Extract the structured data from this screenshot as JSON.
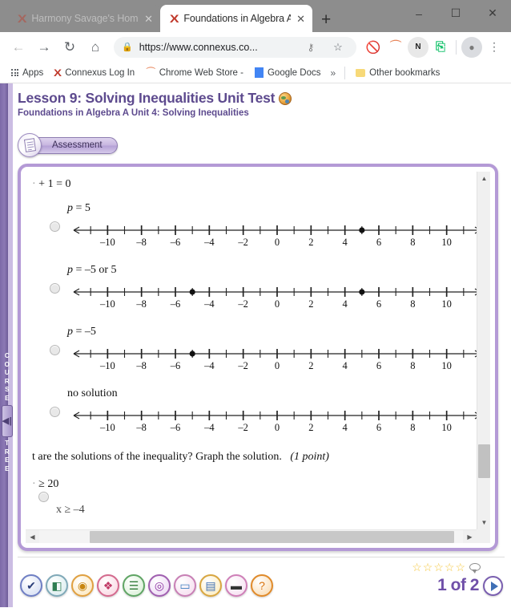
{
  "browser": {
    "tabs": [
      {
        "title": "Harmony Savage's Home",
        "active": false,
        "favicon": "connexus-x-icon"
      },
      {
        "title": "Foundations in Algebra A:",
        "active": true,
        "favicon": "connexus-x-icon"
      }
    ],
    "new_tab_label": "+",
    "window_controls": {
      "minimize": "–",
      "maximize": "☐",
      "close": "✕"
    },
    "nav": {
      "back": "←",
      "forward": "→",
      "reload": "↻",
      "home": "⌂"
    },
    "omnibox": {
      "url": "https://www.connexus.co...",
      "lock_icon": "lock-icon",
      "key_icon": "key-icon",
      "star_icon": "star-outline-icon"
    },
    "extensions": [
      {
        "name": "adblock-icon",
        "glyph": "⃠",
        "color": "#2b6cb8"
      },
      {
        "name": "honey-icon",
        "glyph": "⌒",
        "color": "#e8855a"
      },
      {
        "name": "notion-clipper-icon",
        "glyph": "N",
        "color": "#3a3a3a"
      },
      {
        "name": "grammarly-icon",
        "glyph": "G",
        "color": "#15c26b"
      }
    ],
    "profile_icon": "profile-avatar-icon",
    "menu_icon": "three-dot-menu-icon",
    "bookmarks": [
      {
        "label": "Apps",
        "icon": "apps-grid-icon"
      },
      {
        "label": "Connexus Log In",
        "icon": "connexus-x-icon"
      },
      {
        "label": "Chrome Web Store -",
        "icon": "chrome-web-store-icon"
      },
      {
        "label": "Google Docs",
        "icon": "google-docs-icon"
      }
    ],
    "overflow_label": "»",
    "other_bookmarks_label": "Other bookmarks"
  },
  "sidebar": {
    "label_line1": "COURSE",
    "label_line2": "TREE",
    "collapse_icon": "collapse-left-icon"
  },
  "header": {
    "title": "Lesson 9: Solving Inequalities Unit Test",
    "title_icon": "globe-icon",
    "subtitle": "Foundations in Algebra A  Unit 4: Solving Inequalities",
    "assessment_label": "Assessment",
    "assessment_icon": "assessment-paper-icon"
  },
  "question": {
    "equation_fragment": "+ 1 = 0",
    "options": [
      {
        "label": "p = 5",
        "label_html": "p = 5",
        "points": [
          5
        ]
      },
      {
        "label": "p = –5 or 5",
        "label_html": "p = –5 or 5",
        "points": [
          -5,
          5
        ]
      },
      {
        "label": "p = –5",
        "label_html": "p = –5",
        "points": [
          -5
        ]
      },
      {
        "label": "no solution",
        "label_html": "no solution",
        "points": []
      }
    ],
    "number_line": {
      "min": -12,
      "max": 12,
      "tick_labels": [
        -10,
        -8,
        -6,
        -4,
        -2,
        0,
        2,
        4,
        6,
        8,
        10
      ],
      "arrow_left": true,
      "arrow_right": true
    },
    "next_question_text": "t are the solutions of the inequality? Graph the solution.",
    "next_question_points": "(1 point)",
    "next_answer_fragment": "≥ 20",
    "partial_option_fragment": "x ≥ –4"
  },
  "panel_scrollbars": {
    "vertical_up": "▲",
    "vertical_down": "▼",
    "horizontal_left": "◀",
    "horizontal_right": "▶"
  },
  "toolbar": {
    "icons": [
      {
        "name": "check-mark-tool",
        "glyph": "✔",
        "ring": "#6f7fc4",
        "fill": "#dfe6f6",
        "color": "#2b3f7a"
      },
      {
        "name": "notebook-tool",
        "glyph": "◧",
        "ring": "#7fa9b8",
        "fill": "#e2f0f2",
        "color": "#2e7d52"
      },
      {
        "name": "coins-tool",
        "glyph": "◉",
        "ring": "#e0a040",
        "fill": "#fdeccb",
        "color": "#c8860f"
      },
      {
        "name": "pushpin-tool",
        "glyph": "❖",
        "ring": "#d46a8e",
        "fill": "#fbdfe8",
        "color": "#c03a66"
      },
      {
        "name": "checklist-tool",
        "glyph": "☰",
        "ring": "#5fa564",
        "fill": "#e2f3e0",
        "color": "#2f7a37"
      },
      {
        "name": "target-tool",
        "glyph": "◎",
        "ring": "#a05fb0",
        "fill": "#f0e0f6",
        "color": "#8a2fa0"
      },
      {
        "name": "monitor-tool",
        "glyph": "▭",
        "ring": "#c87fb5",
        "fill": "#f7e4f2",
        "color": "#3f7fc0"
      },
      {
        "name": "scanner-tool",
        "glyph": "▤",
        "ring": "#d8a640",
        "fill": "#fdf0cd",
        "color": "#3f6fb0"
      },
      {
        "name": "printer-tool",
        "glyph": "▬",
        "ring": "#cf7fb8",
        "fill": "#f8e6f4",
        "color": "#333333"
      },
      {
        "name": "help-tool",
        "glyph": "?",
        "ring": "#e08a2a",
        "fill": "#fbe3c3",
        "color": "#d9730d"
      }
    ],
    "stars": {
      "count": 5,
      "filled": 0,
      "icon": "star-icon"
    },
    "comment_icon": "speech-bubble-icon",
    "page_indicator": "1 of 2",
    "next_icon": "next-arrow-icon"
  },
  "colors": {
    "brand_purple": "#5d4a8e",
    "panel_border": "#b49ad6",
    "rail": "#7d6aa8",
    "page_number": "#6f4fa8",
    "star": "#f5c841"
  }
}
